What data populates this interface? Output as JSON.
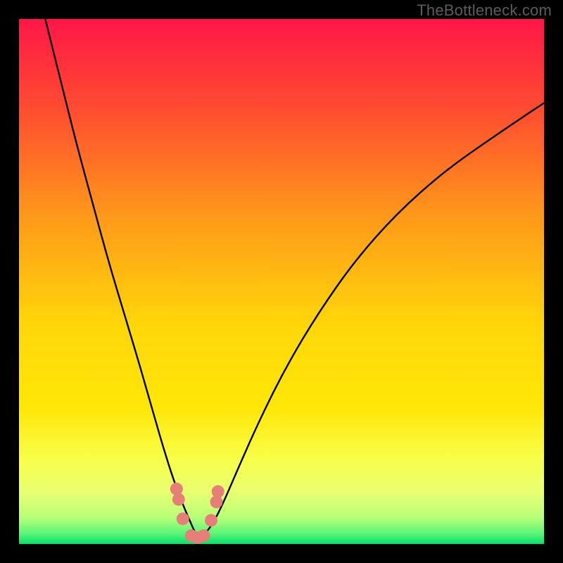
{
  "watermark": "TheBottleneck.com",
  "colors": {
    "gradient_top": "#ff1648",
    "gradient_mid1": "#ff9a1a",
    "gradient_mid2": "#ffe708",
    "gradient_mid3": "#f8ff4a",
    "gradient_bottom": "#02e16a",
    "curve": "#000000",
    "markers": "#e77f79",
    "frame": "#000000"
  },
  "chart_data": {
    "type": "line",
    "title": "",
    "xlabel": "",
    "ylabel": "",
    "xlim": [
      0,
      100
    ],
    "ylim": [
      0,
      100
    ],
    "series": [
      {
        "name": "bottleneck-curve",
        "x": [
          5,
          8,
          11,
          14,
          17,
          20,
          23,
          25,
          27,
          29,
          31,
          32.5,
          33.5,
          34.5,
          35.5,
          37,
          39,
          42,
          46,
          51,
          57,
          64,
          72,
          81,
          91,
          100
        ],
        "y": [
          100,
          88,
          76,
          65,
          54,
          44,
          34,
          27,
          20,
          13.5,
          8,
          4.5,
          2.2,
          1.2,
          2.0,
          4.0,
          8.0,
          15,
          24,
          34,
          44,
          54,
          63,
          71,
          78,
          84
        ]
      }
    ],
    "markers": {
      "name": "highlight-dots",
      "x": [
        30.0,
        30.4,
        31.2,
        32.8,
        34.0,
        35.2,
        36.6,
        37.6,
        37.9
      ],
      "y": [
        10.5,
        8.5,
        4.8,
        1.6,
        1.2,
        1.6,
        4.5,
        8.0,
        10.0
      ]
    },
    "grid": false,
    "legend": false
  }
}
